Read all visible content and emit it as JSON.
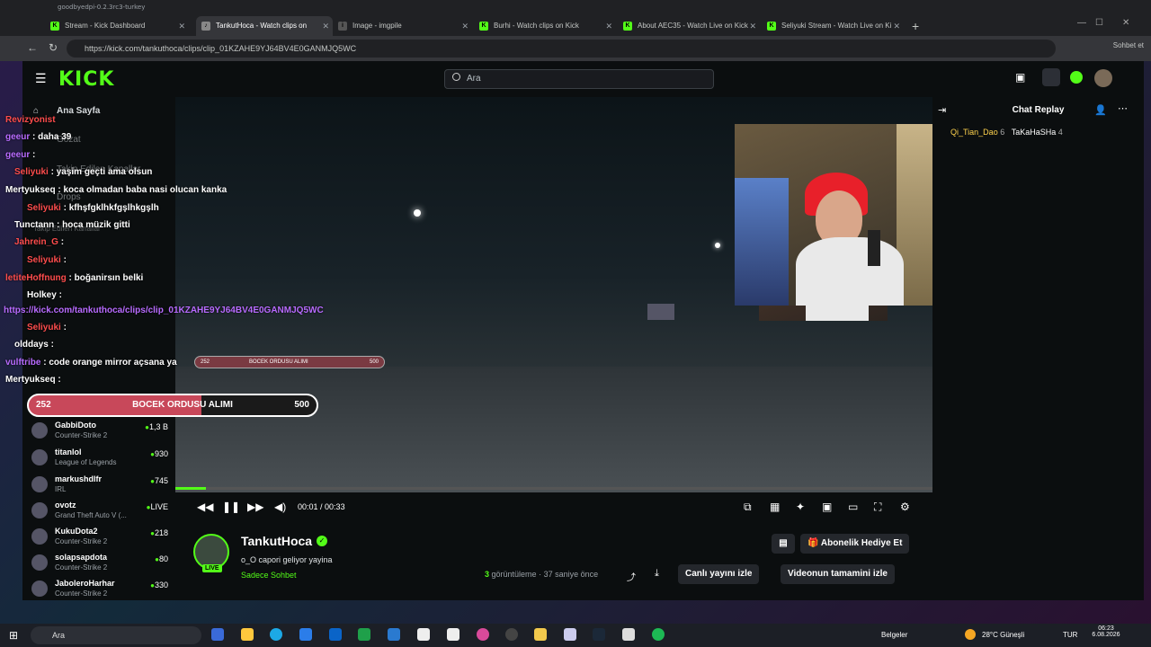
{
  "window": {
    "title": "goodbyedpi-0.2.3rc3-turkey"
  },
  "tabs": [
    {
      "label": "Stream - Kick Dashboard"
    },
    {
      "label": "TankutHoca - Watch clips on",
      "active": true
    },
    {
      "label": "Image - imgpile"
    },
    {
      "label": "Burhi - Watch clips on Kick"
    },
    {
      "label": "About AEC35 - Watch Live on Kick"
    },
    {
      "label": "Seliyuki Stream - Watch Live on Ki"
    }
  ],
  "address": {
    "url": "https://kick.com/tankuthoca/clips/clip_01KZAHE9YJ64BV4E0GANMJQ5WC"
  },
  "browser": {
    "chat_label": "Sohbet et"
  },
  "kick": {
    "logo": "KICK",
    "search_placeholder": "Ara",
    "sidebar": {
      "home": "Ana Sayfa",
      "browse": "Gözat",
      "followed": "Takip Edilen Kanallar",
      "drops": "Drops",
      "followed2": "Takip Edilen Kanallar"
    },
    "channels": [
      {
        "name": "GabbiDoto",
        "game": "Counter-Strike 2",
        "viewers": "1,3 B"
      },
      {
        "name": "titanlol",
        "game": "League of Legends",
        "viewers": "930"
      },
      {
        "name": "markushdlfr",
        "game": "IRL",
        "viewers": "745"
      },
      {
        "name": "ovotz",
        "game": "Grand Theft Auto V (...",
        "viewers": "LIVE"
      },
      {
        "name": "KukuDota2",
        "game": "Counter-Strike 2",
        "viewers": "218"
      },
      {
        "name": "solapsapdota",
        "game": "Counter-Strike 2",
        "viewers": "80"
      },
      {
        "name": "JaboleroHarhar",
        "game": "Counter-Strike 2",
        "viewers": "330"
      }
    ],
    "player": {
      "time_current": "00:01",
      "time_total": "00:33",
      "progress": 0.04
    },
    "streamer": {
      "name": "TankutHoca",
      "title": "o_O capori geliyor yayina",
      "category": "Sadece Sohbet",
      "live": "LIVE",
      "views_count": "3",
      "views_text": "görüntüleme",
      "ago": "37 saniye önce"
    },
    "buttons": {
      "gift": "Abonelik Hediye Et",
      "watch_live": "Canlı yayını izle",
      "watch_full": "Videonun tamamini izle"
    },
    "chat": {
      "title": "Chat Replay",
      "user1": "Qi_Tian_Dao",
      "user1_count": "6",
      "user2": "TaKaHaSHa",
      "user2_count": "4"
    }
  },
  "overlay_chat": [
    {
      "user": "Revizyonist",
      "text": "",
      "style": "red"
    },
    {
      "user": "geeur",
      "text": "daha 39",
      "style": "purple"
    },
    {
      "user": "geeur",
      "text": "",
      "style": "purple"
    },
    {
      "user": "Seliyuki",
      "text": "yaşim geçti ama olsun",
      "style": "red"
    },
    {
      "user": "Mertyukseq",
      "text": "koca olmadan baba nasi olucan kanka",
      "style": "white"
    },
    {
      "user": "Seliyuki",
      "text": "kfhşfgklhkfgşlhkgşlh",
      "style": "red"
    },
    {
      "user": "Tunctann",
      "text": "hoca müzik gitti",
      "style": "white"
    },
    {
      "user": "Jahrein_G",
      "text": "",
      "style": "red"
    },
    {
      "user": "Seliyuki",
      "text": "",
      "style": "red"
    },
    {
      "user": "letiteHoffnung",
      "text": "boğanirsın belki",
      "style": "red"
    },
    {
      "user": "Holkey",
      "text": "",
      "style": "white"
    },
    {
      "user": "https://kick.com/tankuthoca/clips/clip_01KZAHE9YJ64BV4E0GANMJQ5WC",
      "text": "",
      "style": "purple"
    },
    {
      "user": "Seliyuki",
      "text": "",
      "style": "red"
    },
    {
      "user": "olddays",
      "text": "",
      "style": "white"
    },
    {
      "user": "vulftribe",
      "text": "code orange mirror açsana ya",
      "style": "purple"
    },
    {
      "user": "Mertyukseq",
      "text": "",
      "style": "white"
    }
  ],
  "bocek": {
    "left": "252",
    "label": "BOCEK ORDUSU ALIMI",
    "right": "500"
  },
  "taskbar": {
    "search": "Ara",
    "docs": "Belgeler",
    "weather": "28°C Güneşli",
    "lang": "TUR",
    "time": "06:23",
    "date": "6.08.2026"
  }
}
